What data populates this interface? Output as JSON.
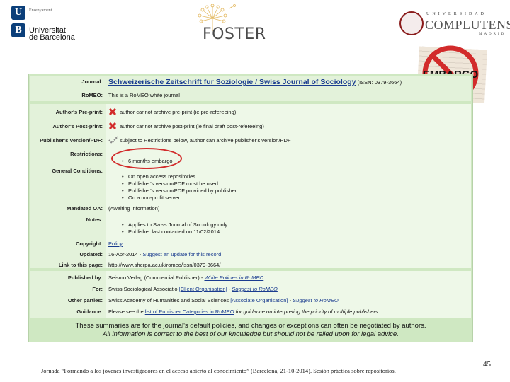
{
  "header": {
    "ub": {
      "small_text": "Ensenyament",
      "name_line1": "Universitat",
      "name_line2": "de Barcelona"
    },
    "foster": {
      "text": "FOSTER"
    },
    "ucm": {
      "line1": "UNIVERSIDAD",
      "line2": "COMPLUTENSE",
      "line3": "MADRID"
    },
    "embargo_text": "EMBARGO"
  },
  "romeo": {
    "journal_label": "Journal:",
    "journal_title": "Schweizerische Zeitschrift fur Soziologie / Swiss Journal of Sociology",
    "journal_issn": "(ISSN: 0379-3664)",
    "romeo_label": "RoMEO:",
    "romeo_value": "This is a RoMEO white journal",
    "preprint_label": "Author's Pre-print:",
    "preprint_value": "author cannot archive pre-print (ie pre-refereeing)",
    "postprint_label": "Author's Post-print:",
    "postprint_value": "author cannot archive post-print (ie final draft post-refereeing)",
    "publisher_pdf_label": "Publisher's Version/PDF:",
    "publisher_pdf_value": "subject to Restrictions below, author can archive publisher's version/PDF",
    "restrictions_label": "Restrictions:",
    "restrictions": [
      "6 months embargo"
    ],
    "general_label": "General Conditions:",
    "general_conditions": [
      "On open access repositories",
      "Publisher's version/PDF must be used",
      "Publisher's version/PDF provided by publisher",
      "On a non-profit server"
    ],
    "mandated_label": "Mandated OA:",
    "mandated_value": "(Awaiting information)",
    "notes_label": "Notes:",
    "notes": [
      "Applies to Swiss Journal of Sociology only",
      "Publisher last contacted on 11/02/2014"
    ],
    "copyright_label": "Copyright:",
    "copyright_value": "Policy",
    "updated_label": "Updated:",
    "updated_date": "16-Apr-2014",
    "updated_sep": " - ",
    "updated_link": "Suggest an update for this record",
    "link_label": "Link to this page:",
    "link_value": "http://www.sherpa.ac.uk/romeo/issn/0379-3664/",
    "published_label": "Published by:",
    "published_value": "Seismo Verlag (Commercial Publisher)",
    "published_sep": " - ",
    "published_link": "White Policies in RoMEO",
    "for_label": "For:",
    "for_value": "Swiss Sociological Associatio",
    "for_link1": "[Client Organisation]",
    "for_sep": " - ",
    "for_link2": "Suggest to RoMEO",
    "other_label": "Other parties:",
    "other_value": "Swiss Academy of Humanities and Social Sciences",
    "other_link1": "[Associate Organisation]",
    "other_sep": " - ",
    "other_link2": "Suggest to RoMEO",
    "guidance_label": "Guidance:",
    "guidance_pre": "Please see the ",
    "guidance_link": "list of Publisher Categories in RoMEO",
    "guidance_post": " for guidance on interpreting the priority of multiple publishers",
    "footer_line1": "These summaries are for the journal's default policies, and changes or exceptions can often be negotiated by authors.",
    "footer_line2": "All information is correct to the best of our knowledge but should not be relied upon for legal advice."
  },
  "caption": "Jornada “Formando a los jóvenes investigadores en el acceso abierto al conocimiento” (Barcelona, 21-10-2014). Sesión práctica sobre repositorios.",
  "page_number": "45",
  "colors": {
    "panel_green": "#cfe8c2",
    "link_blue": "#1a3c8f",
    "embargo_red": "#d22b2b"
  }
}
